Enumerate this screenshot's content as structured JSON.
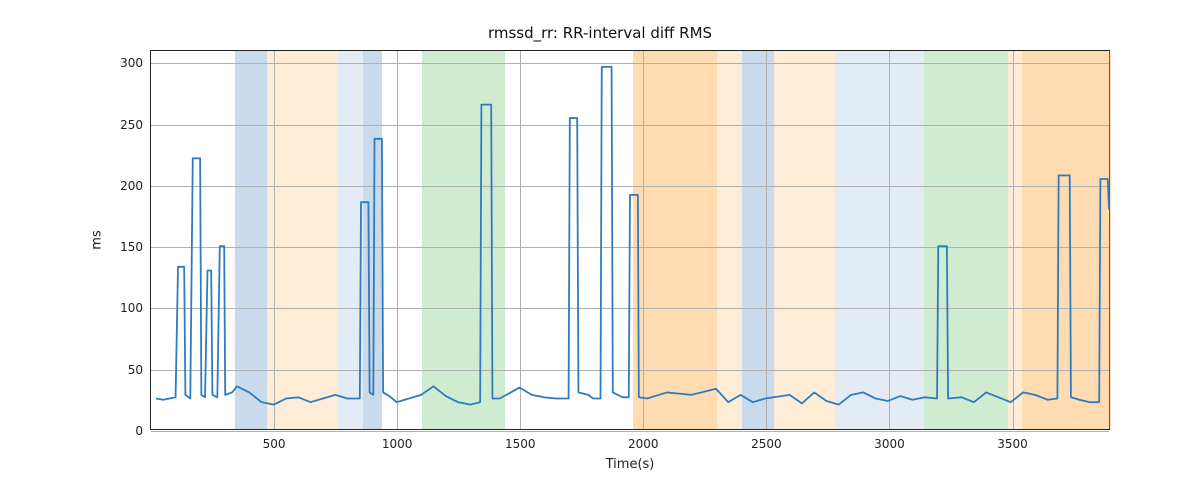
{
  "chart_data": {
    "type": "line",
    "title": "rmssd_rr: RR-interval diff RMS",
    "xlabel": "Time(s)",
    "ylabel": "ms",
    "xlim": [
      0,
      3900
    ],
    "ylim": [
      0,
      310
    ],
    "xticks": [
      500,
      1000,
      1500,
      2000,
      2500,
      3000,
      3500
    ],
    "yticks": [
      0,
      50,
      100,
      150,
      200,
      250,
      300
    ],
    "bands": [
      {
        "x0": 340,
        "x1": 470,
        "color": "blue"
      },
      {
        "x0": 470,
        "x1": 760,
        "color": "orangeL"
      },
      {
        "x0": 760,
        "x1": 860,
        "color": "blueL"
      },
      {
        "x0": 860,
        "x1": 940,
        "color": "blue"
      },
      {
        "x0": 1100,
        "x1": 1440,
        "color": "green"
      },
      {
        "x0": 1960,
        "x1": 2300,
        "color": "orange"
      },
      {
        "x0": 2300,
        "x1": 2400,
        "color": "orangeL"
      },
      {
        "x0": 2400,
        "x1": 2530,
        "color": "blue"
      },
      {
        "x0": 2530,
        "x1": 2780,
        "color": "orangeL"
      },
      {
        "x0": 2780,
        "x1": 3140,
        "color": "blueL"
      },
      {
        "x0": 3140,
        "x1": 3480,
        "color": "green"
      },
      {
        "x0": 3480,
        "x1": 3540,
        "color": "orangeL"
      },
      {
        "x0": 3540,
        "x1": 3900,
        "color": "orange"
      }
    ],
    "series": [
      {
        "name": "rmssd_rr",
        "color": "#2f7bbf",
        "points": [
          [
            20,
            25
          ],
          [
            50,
            24
          ],
          [
            100,
            26
          ],
          [
            110,
            133
          ],
          [
            135,
            133
          ],
          [
            140,
            28
          ],
          [
            160,
            25
          ],
          [
            170,
            222
          ],
          [
            200,
            222
          ],
          [
            205,
            28
          ],
          [
            220,
            26
          ],
          [
            230,
            130
          ],
          [
            245,
            130
          ],
          [
            250,
            28
          ],
          [
            270,
            26
          ],
          [
            280,
            150
          ],
          [
            298,
            150
          ],
          [
            302,
            28
          ],
          [
            330,
            30
          ],
          [
            350,
            35
          ],
          [
            400,
            30
          ],
          [
            450,
            22
          ],
          [
            500,
            20
          ],
          [
            550,
            25
          ],
          [
            600,
            26
          ],
          [
            650,
            22
          ],
          [
            700,
            25
          ],
          [
            750,
            28
          ],
          [
            800,
            25
          ],
          [
            850,
            25
          ],
          [
            855,
            186
          ],
          [
            885,
            186
          ],
          [
            890,
            30
          ],
          [
            905,
            28
          ],
          [
            910,
            238
          ],
          [
            940,
            238
          ],
          [
            945,
            30
          ],
          [
            970,
            27
          ],
          [
            1000,
            22
          ],
          [
            1050,
            25
          ],
          [
            1100,
            28
          ],
          [
            1150,
            35
          ],
          [
            1200,
            27
          ],
          [
            1250,
            22
          ],
          [
            1300,
            20
          ],
          [
            1340,
            22
          ],
          [
            1345,
            266
          ],
          [
            1385,
            266
          ],
          [
            1390,
            25
          ],
          [
            1420,
            25
          ],
          [
            1500,
            34
          ],
          [
            1550,
            28
          ],
          [
            1600,
            26
          ],
          [
            1650,
            25
          ],
          [
            1700,
            25
          ],
          [
            1705,
            255
          ],
          [
            1735,
            255
          ],
          [
            1740,
            30
          ],
          [
            1780,
            28
          ],
          [
            1800,
            25
          ],
          [
            1830,
            25
          ],
          [
            1835,
            297
          ],
          [
            1875,
            297
          ],
          [
            1880,
            30
          ],
          [
            1920,
            26
          ],
          [
            1945,
            26
          ],
          [
            1950,
            192
          ],
          [
            1982,
            192
          ],
          [
            1986,
            26
          ],
          [
            2020,
            25
          ],
          [
            2100,
            30
          ],
          [
            2200,
            28
          ],
          [
            2300,
            33
          ],
          [
            2350,
            22
          ],
          [
            2400,
            28
          ],
          [
            2450,
            22
          ],
          [
            2500,
            25
          ],
          [
            2600,
            28
          ],
          [
            2650,
            21
          ],
          [
            2700,
            30
          ],
          [
            2750,
            23
          ],
          [
            2800,
            20
          ],
          [
            2850,
            28
          ],
          [
            2900,
            30
          ],
          [
            2950,
            25
          ],
          [
            3000,
            23
          ],
          [
            3050,
            27
          ],
          [
            3100,
            24
          ],
          [
            3150,
            26
          ],
          [
            3200,
            25
          ],
          [
            3205,
            150
          ],
          [
            3240,
            150
          ],
          [
            3245,
            25
          ],
          [
            3300,
            26
          ],
          [
            3350,
            22
          ],
          [
            3400,
            30
          ],
          [
            3450,
            26
          ],
          [
            3500,
            22
          ],
          [
            3550,
            30
          ],
          [
            3600,
            28
          ],
          [
            3650,
            24
          ],
          [
            3690,
            25
          ],
          [
            3695,
            208
          ],
          [
            3740,
            208
          ],
          [
            3745,
            26
          ],
          [
            3780,
            24
          ],
          [
            3820,
            22
          ],
          [
            3860,
            22
          ],
          [
            3865,
            205
          ],
          [
            3895,
            205
          ],
          [
            3900,
            180
          ]
        ]
      }
    ]
  }
}
